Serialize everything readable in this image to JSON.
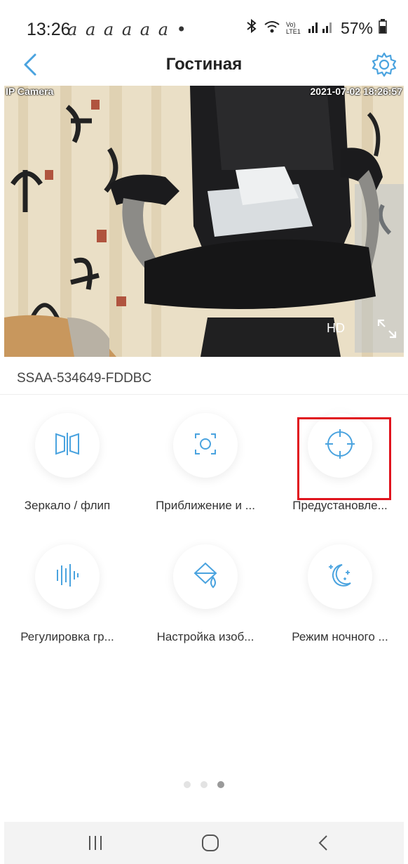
{
  "status": {
    "time": "13:26",
    "notifications": "a a a a a a •",
    "network_label": "Vo) LTE1",
    "battery": "57%"
  },
  "header": {
    "title": "Гостиная",
    "back_icon": "back-arrow-icon",
    "settings_icon": "gear-icon"
  },
  "video": {
    "overlay_label": "IP Camera",
    "timestamp": "2021-07-02 18:26:57",
    "quality_label": "HD",
    "fullscreen_icon": "expand-icon"
  },
  "device": {
    "id": "SSAA-534649-FDDBC"
  },
  "features": [
    {
      "label": "Зеркало / флип",
      "icon": "mirror-flip-icon"
    },
    {
      "label": "Приближение и ...",
      "icon": "zoom-focus-icon"
    },
    {
      "label": "Предустановле...",
      "icon": "preset-crosshair-icon"
    },
    {
      "label": "Регулировка гр...",
      "icon": "volume-waveform-icon"
    },
    {
      "label": "Настройка изоб...",
      "icon": "image-settings-icon"
    },
    {
      "label": "Режим ночного ...",
      "icon": "night-mode-icon"
    }
  ],
  "pager": {
    "count": 3,
    "active_index": 2
  },
  "colors": {
    "accent": "#4aa3df",
    "highlight": "#e0141e"
  }
}
